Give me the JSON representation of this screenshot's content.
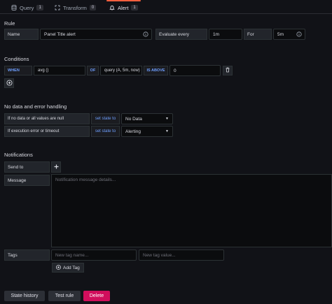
{
  "tabs": [
    {
      "label": "Query",
      "count": "1",
      "icon": "database-icon"
    },
    {
      "label": "Transform",
      "count": "0",
      "icon": "transform-icon"
    },
    {
      "label": "Alert",
      "count": "1",
      "icon": "bell-icon"
    }
  ],
  "rule": {
    "section_title": "Rule",
    "name_label": "Name",
    "name_value": "Panel Title alert",
    "evaluate_label": "Evaluate every",
    "evaluate_value": "1m",
    "for_label": "For",
    "for_value": "5m"
  },
  "conditions": {
    "section_title": "Conditions",
    "when": "WHEN",
    "func": "avg ()",
    "of": "OF",
    "query": "query (A, 5m, now)",
    "evaluator": "IS ABOVE",
    "threshold": "0"
  },
  "nodata": {
    "section_title": "No data and error handling",
    "row1_label": "If no data or all values are null",
    "row1_set_state": "set state to",
    "row1_value": "No Data",
    "row2_label": "If execution error or timeout",
    "row2_set_state": "set state to",
    "row2_value": "Alerting"
  },
  "notifications": {
    "section_title": "Notifications",
    "send_to_label": "Send to",
    "message_label": "Message",
    "message_placeholder": "Notification message details...",
    "tags_label": "Tags",
    "tag_name_placeholder": "New tag name...",
    "tag_value_placeholder": "New tag value...",
    "add_tag": "Add Tag"
  },
  "footer": {
    "state_history": "State history",
    "test_rule": "Test rule",
    "delete": "Delete"
  },
  "colors": {
    "accent_tab": "#f55f3e",
    "keyword_blue": "#6e9fff",
    "delete_red": "#d10e5c"
  }
}
